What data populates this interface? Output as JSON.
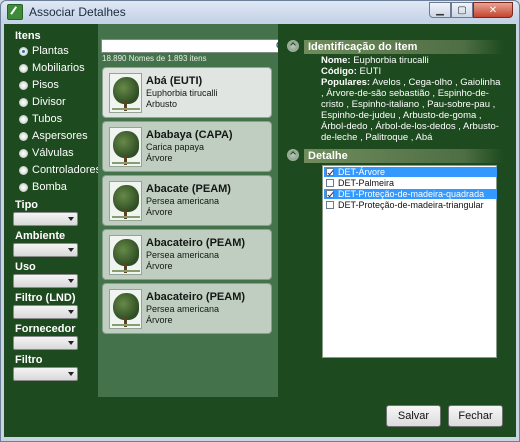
{
  "window": {
    "title": "Associar Detalhes"
  },
  "sidebar": {
    "items_header": "Itens",
    "items": [
      {
        "label": "Plantas",
        "selected": true
      },
      {
        "label": "Mobiliarios",
        "selected": false
      },
      {
        "label": "Pisos",
        "selected": false
      },
      {
        "label": "Divisor",
        "selected": false
      },
      {
        "label": "Tubos",
        "selected": false
      },
      {
        "label": "Aspersores",
        "selected": false
      },
      {
        "label": "Válvulas",
        "selected": false
      },
      {
        "label": "Controladores",
        "selected": false
      },
      {
        "label": "Bomba",
        "selected": false
      }
    ],
    "filters": [
      {
        "label": "Tipo",
        "value": ""
      },
      {
        "label": "Ambiente",
        "value": ""
      },
      {
        "label": "Uso",
        "value": ""
      },
      {
        "label": "Filtro (LND)",
        "value": ""
      },
      {
        "label": "Fornecedor",
        "value": ""
      },
      {
        "label": "Filtro",
        "value": ""
      }
    ]
  },
  "center": {
    "search_value": "",
    "count_text": "18.890 Nomes de 1.893 itens",
    "cards": [
      {
        "name": "Abá (EUTI)",
        "scientific": "Euphorbia tirucalli",
        "type": "Arbusto",
        "selected": true
      },
      {
        "name": "Ababaya (CAPA)",
        "scientific": "Carica papaya",
        "type": "Árvore",
        "selected": false
      },
      {
        "name": "Abacate (PEAM)",
        "scientific": "Persea americana",
        "type": "Árvore",
        "selected": false
      },
      {
        "name": "Abacateiro (PEAM)",
        "scientific": "Persea americana",
        "type": "Árvore",
        "selected": false
      },
      {
        "name": "Abacateiro (PEAM)",
        "scientific": "Persea americana",
        "type": "Árvore",
        "selected": false
      }
    ]
  },
  "right": {
    "id_section_title": "Identificação do Item",
    "name_label": "Nome:",
    "name_value": "Euphorbia tirucalli",
    "code_label": "Código:",
    "code_value": "EUTI",
    "popular_label": "Populares:",
    "popular_value": "Avelos , Cega-olho , Gaiolinha , Árvore-de-são sebastião , Espinho-de-cristo , Espinho-italiano , Pau-sobre-pau , Espinho-de-judeu , Arbusto-de-goma , Árbol-dedo , Árbol-de-los-dedos , Arbusto-de-leche , Palitroque , Abá",
    "detail_section_title": "Detalhe",
    "details": [
      {
        "label": "DET-Árvore",
        "checked": true,
        "selected": true
      },
      {
        "label": "DET-Palmeira",
        "checked": false,
        "selected": false
      },
      {
        "label": "DET-Proteção-de-madeira-quadrada",
        "checked": true,
        "selected": true
      },
      {
        "label": "DET-Proteção-de-madeira-triangular",
        "checked": false,
        "selected": false
      }
    ]
  },
  "buttons": {
    "save": "Salvar",
    "close": "Fechar"
  },
  "colors": {
    "panel": "#1d4a1e",
    "list_panel": "#44724a",
    "selection": "#3399ff"
  }
}
